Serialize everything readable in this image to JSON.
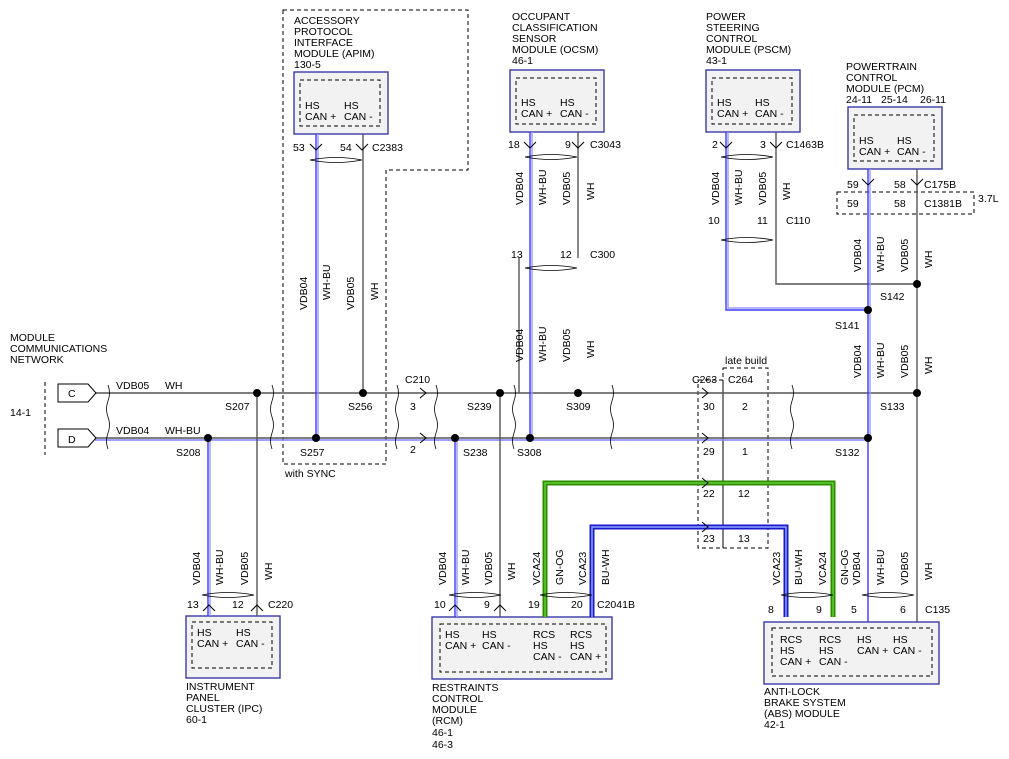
{
  "network": {
    "title": [
      "MODULE",
      "COMMUNICATIONS",
      "NETWORK"
    ],
    "ref": "14-1",
    "conn_c": "C",
    "conn_d": "D"
  },
  "modules": {
    "apim": {
      "name": [
        "ACCESSORY",
        "PROTOCOL",
        "INTERFACE",
        "MODULE (APIM)",
        "130-5"
      ],
      "pins": [
        "53",
        "54"
      ],
      "connector": "C2383",
      "note": "with SYNC"
    },
    "ocsm": {
      "name": [
        "OCCUPANT",
        "CLASSIFICATION",
        "SENSOR",
        "MODULE (OCSM)",
        "46-1"
      ],
      "pins": [
        "18",
        "9"
      ],
      "connector": "C3043"
    },
    "pscm": {
      "name": [
        "POWER",
        "STEERING",
        "CONTROL",
        "MODULE (PSCM)",
        "43-1"
      ],
      "pins": [
        "2",
        "3"
      ],
      "connector": "C1463B"
    },
    "pcm": {
      "name": [
        "POWERTRAIN",
        "CONTROL",
        "MODULE (PCM)"
      ],
      "refs": [
        "24-11",
        "25-14",
        "26-11"
      ],
      "pins": [
        "59",
        "58"
      ],
      "connector": "C175B",
      "pins2": [
        "59",
        "58"
      ],
      "connector2": "C1381B",
      "engine": "3.7L"
    },
    "ipc": {
      "name": [
        "INSTRUMENT",
        "PANEL",
        "CLUSTER (IPC)",
        "60-1"
      ],
      "pins": [
        "13",
        "12"
      ],
      "connector": "C220"
    },
    "rcm": {
      "name": [
        "RESTRAINTS",
        "CONTROL",
        "MODULE",
        "(RCM)",
        "46-1",
        "46-3"
      ],
      "pins": [
        "10",
        "9",
        "19",
        "20"
      ],
      "connector": "C2041B"
    },
    "abs": {
      "name": [
        "ANTI-LOCK",
        "BRAKE SYSTEM",
        "(ABS) MODULE",
        "42-1"
      ],
      "pins": [
        "8",
        "9",
        "5",
        "6"
      ],
      "connector": "C135"
    }
  },
  "terminals": {
    "hs_can_plus": [
      "HS",
      "CAN +"
    ],
    "hs_can_minus": [
      "HS",
      "CAN -"
    ],
    "rcs_plus": [
      "RCS",
      "HS",
      "CAN +"
    ],
    "rcs_minus": [
      "RCS",
      "HS",
      "CAN -"
    ]
  },
  "wires": {
    "vdb05": "VDB05",
    "vdb04": "VDB04",
    "wh": "WH",
    "whbu": "WH-BU",
    "vca24": "VCA24",
    "vca23": "VCA23",
    "gnog": "GN-OG",
    "buwh": "BU-WH"
  },
  "splices": {
    "s207": "S207",
    "s208": "S208",
    "s256": "S256",
    "s257": "S257",
    "s239": "S239",
    "s238": "S238",
    "s308": "S308",
    "s309": "S309",
    "s133": "S133",
    "s132": "S132",
    "s141": "S141",
    "s142": "S142"
  },
  "connectors": {
    "c210": {
      "name": "C210",
      "pins": [
        "3",
        "2"
      ]
    },
    "c263": {
      "name": "C263",
      "pins": [
        "30",
        "29",
        "22",
        "23"
      ]
    },
    "c264": {
      "name": "C264",
      "pins": [
        "2",
        "1",
        "12",
        "13"
      ],
      "note": "late build"
    },
    "c300": {
      "name": "C300",
      "pins": [
        "13",
        "12"
      ]
    },
    "c110": {
      "name": "C110",
      "pins": [
        "10",
        "11"
      ]
    }
  },
  "colors": {
    "wire_default": "#555555",
    "wire_blue": "#3a3aff",
    "wire_green": "#2e8b00",
    "module_border": "#3a3aa8"
  }
}
